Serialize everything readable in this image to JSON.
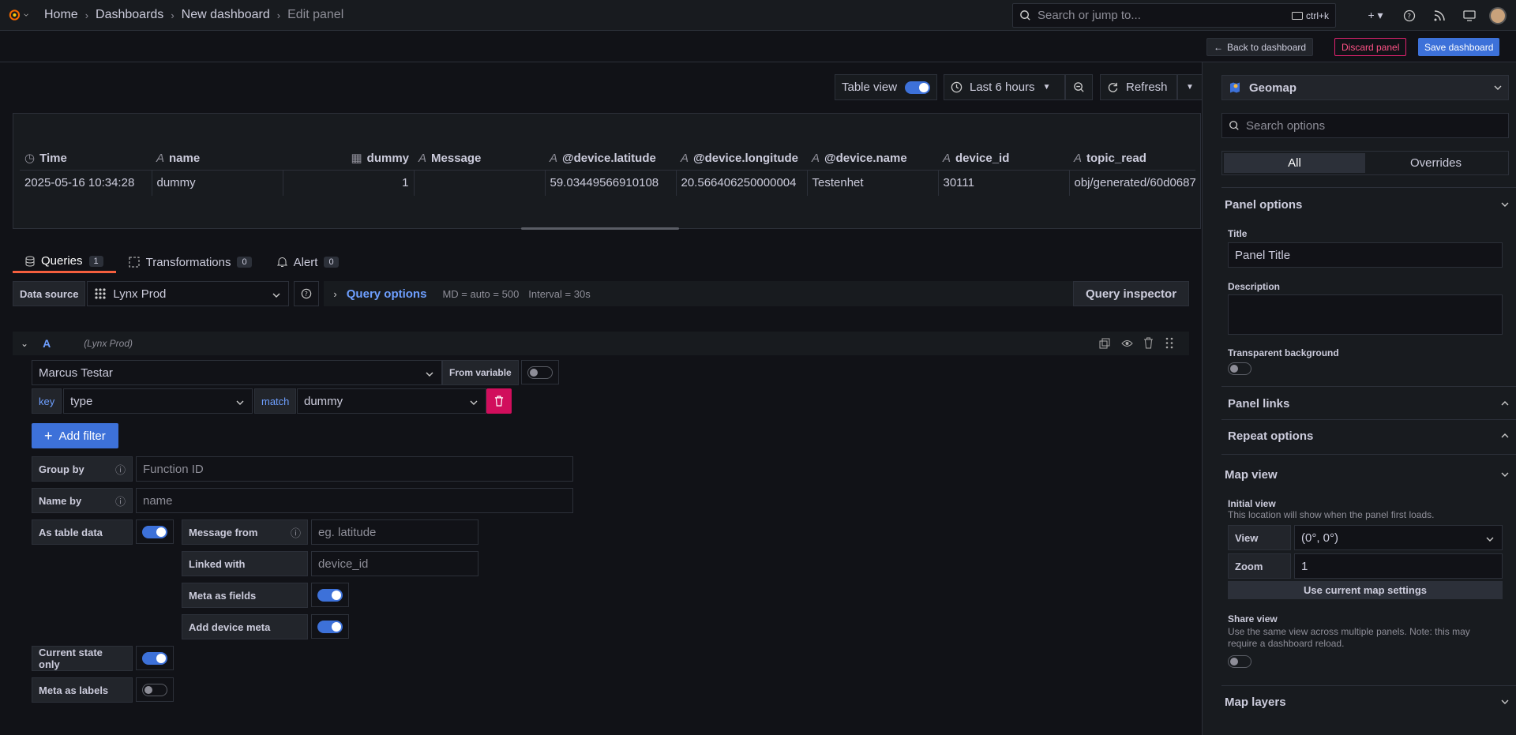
{
  "topbar": {
    "breadcrumbs": [
      "Home",
      "Dashboards",
      "New dashboard",
      "Edit panel"
    ],
    "search_placeholder": "Search or jump to...",
    "search_shortcut": "ctrl+k"
  },
  "actionbar": {
    "back_label": "Back to dashboard",
    "discard_label": "Discard panel",
    "save_label": "Save dashboard"
  },
  "toolbar": {
    "table_view_label": "Table view",
    "table_view_on": true,
    "time_range": "Last 6 hours",
    "refresh_label": "Refresh"
  },
  "table": {
    "columns": [
      {
        "icon": "clock-icon",
        "label": "Time",
        "align": "left"
      },
      {
        "icon": "text-icon",
        "label": "name",
        "align": "left"
      },
      {
        "icon": "number-icon",
        "label": "dummy",
        "align": "right"
      },
      {
        "icon": "text-icon",
        "label": "Message",
        "align": "left"
      },
      {
        "icon": "text-icon",
        "label": "@device.latitude",
        "align": "left"
      },
      {
        "icon": "text-icon",
        "label": "@device.longitude",
        "align": "left"
      },
      {
        "icon": "text-icon",
        "label": "@device.name",
        "align": "left"
      },
      {
        "icon": "text-icon",
        "label": "device_id",
        "align": "left"
      },
      {
        "icon": "text-icon",
        "label": "topic_read",
        "align": "left"
      }
    ],
    "rows": [
      [
        "2025-05-16 10:34:28",
        "dummy",
        "1",
        "",
        "59.03449566910108",
        "20.566406250000004",
        "Testenhet",
        "30111",
        "obj/generated/60d0687"
      ]
    ]
  },
  "tabs": [
    {
      "label": "Queries",
      "count": "1",
      "icon": "database-icon"
    },
    {
      "label": "Transformations",
      "count": "0",
      "icon": "transform-icon"
    },
    {
      "label": "Alert",
      "count": "0",
      "icon": "bell-icon"
    }
  ],
  "query_bar": {
    "datasource_label": "Data source",
    "datasource_value": "Lynx Prod",
    "query_options_label": "Query options",
    "md_text": "MD = auto = 500",
    "interval_text": "Interval = 30s",
    "inspector_label": "Query inspector"
  },
  "query": {
    "ref_id": "A",
    "ds_hint": "(Lynx Prod)",
    "org_value": "Marcus Testar",
    "from_variable_label": "From variable",
    "key_label": "key",
    "key_value": "type",
    "match_label": "match",
    "match_value": "dummy",
    "add_filter_label": "Add filter",
    "group_by_label": "Group by",
    "group_by_placeholder": "Function ID",
    "name_by_label": "Name by",
    "name_by_placeholder": "name",
    "as_table_label": "As table data",
    "message_from_label": "Message from",
    "message_from_placeholder": "eg. latitude",
    "linked_with_label": "Linked with",
    "linked_with_placeholder": "device_id",
    "meta_fields_label": "Meta as fields",
    "add_device_meta_label": "Add device meta",
    "current_state_label": "Current state only",
    "meta_labels_label": "Meta as labels"
  },
  "sidebar": {
    "viz_name": "Geomap",
    "search_placeholder": "Search options",
    "seg_all": "All",
    "seg_overrides": "Overrides",
    "panel_options": "Panel options",
    "title_label": "Title",
    "title_value": "Panel Title",
    "description_label": "Description",
    "transparent_label": "Transparent background",
    "panel_links": "Panel links",
    "repeat_options": "Repeat options",
    "map_view": "Map view",
    "initial_view_label": "Initial view",
    "initial_view_desc": "This location will show when the panel first loads.",
    "view_label": "View",
    "view_value": "(0°, 0°)",
    "zoom_label": "Zoom",
    "zoom_value": "1",
    "use_current_label": "Use current map settings",
    "share_view_label": "Share view",
    "share_view_desc": "Use the same view across multiple panels. Note: this may require a dashboard reload.",
    "map_layers": "Map layers"
  }
}
